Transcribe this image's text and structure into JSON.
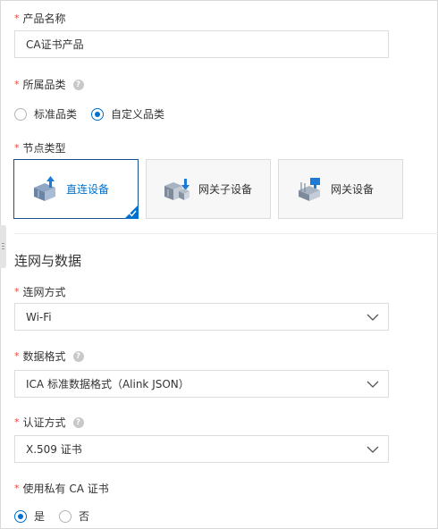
{
  "form": {
    "product_name": {
      "label": "产品名称",
      "value": "CA证书产品"
    },
    "category": {
      "label": "所属品类",
      "options": [
        {
          "label": "标准品类",
          "selected": false
        },
        {
          "label": "自定义品类",
          "selected": true
        }
      ]
    },
    "node_type": {
      "label": "节点类型",
      "cards": [
        {
          "label": "直连设备",
          "selected": true,
          "icon": "direct-device-icon"
        },
        {
          "label": "网关子设备",
          "selected": false,
          "icon": "gateway-subdevice-icon"
        },
        {
          "label": "网关设备",
          "selected": false,
          "icon": "gateway-device-icon"
        }
      ]
    }
  },
  "section": {
    "title": "连网与数据"
  },
  "network": {
    "connect_mode": {
      "label": "连网方式",
      "value": "Wi-Fi"
    },
    "data_format": {
      "label": "数据格式",
      "value": "ICA 标准数据格式（Alink JSON）"
    },
    "auth_mode": {
      "label": "认证方式",
      "value": "X.509 证书"
    },
    "private_ca": {
      "label": "使用私有 CA 证书",
      "options": [
        {
          "label": "是",
          "selected": true
        },
        {
          "label": "否",
          "selected": false
        }
      ]
    }
  },
  "colors": {
    "accent": "#0070cc",
    "required": "#e8443b",
    "border": "#dcdcdc"
  }
}
